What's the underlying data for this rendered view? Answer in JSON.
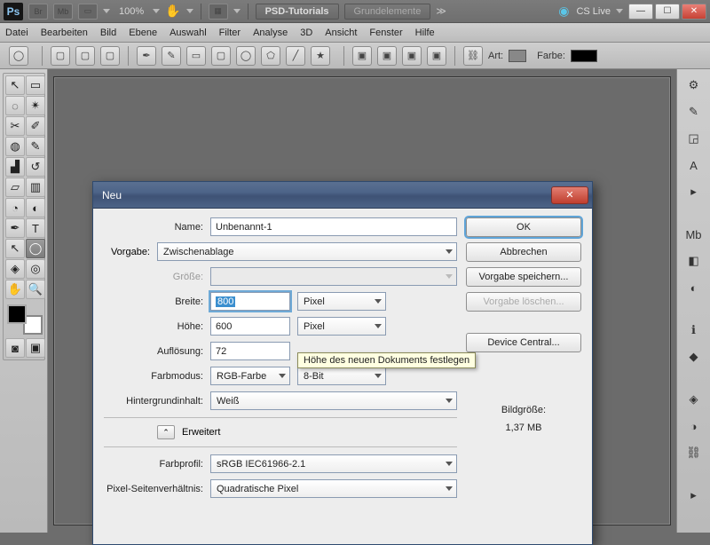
{
  "topbar": {
    "zoom": "100%",
    "tab1": "PSD-Tutorials",
    "tab2": "Grundelemente",
    "cs_live": "CS Live"
  },
  "menubar": [
    "Datei",
    "Bearbeiten",
    "Bild",
    "Ebene",
    "Auswahl",
    "Filter",
    "Analyse",
    "3D",
    "Ansicht",
    "Fenster",
    "Hilfe"
  ],
  "optbar": {
    "art": "Art:",
    "farbe": "Farbe:"
  },
  "dialog": {
    "title": "Neu",
    "labels": {
      "name": "Name:",
      "vorgabe": "Vorgabe:",
      "groesse": "Größe:",
      "breite": "Breite:",
      "hoehe": "Höhe:",
      "aufloesung": "Auflösung:",
      "farbmodus": "Farbmodus:",
      "hg": "Hintergrundinhalt:",
      "erweitert": "Erweitert",
      "farbprofil": "Farbprofil:",
      "pixseit": "Pixel-Seitenverhältnis:"
    },
    "values": {
      "name": "Unbenannt-1",
      "vorgabe": "Zwischenablage",
      "breite": "800",
      "hoehe": "600",
      "aufloesung": "72",
      "farbmodus": "RGB-Farbe",
      "bit": "8-Bit",
      "hg": "Weiß",
      "farbprofil": "sRGB IEC61966-2.1",
      "pixseit": "Quadratische Pixel",
      "px": "Pixel"
    },
    "buttons": {
      "ok": "OK",
      "abbrechen": "Abbrechen",
      "speichern": "Vorgabe speichern...",
      "loeschen": "Vorgabe löschen...",
      "device": "Device Central..."
    },
    "bildgroesse_label": "Bildgröße:",
    "bildgroesse_val": "1,37 MB",
    "tooltip": "Höhe des neuen Dokuments festlegen"
  }
}
